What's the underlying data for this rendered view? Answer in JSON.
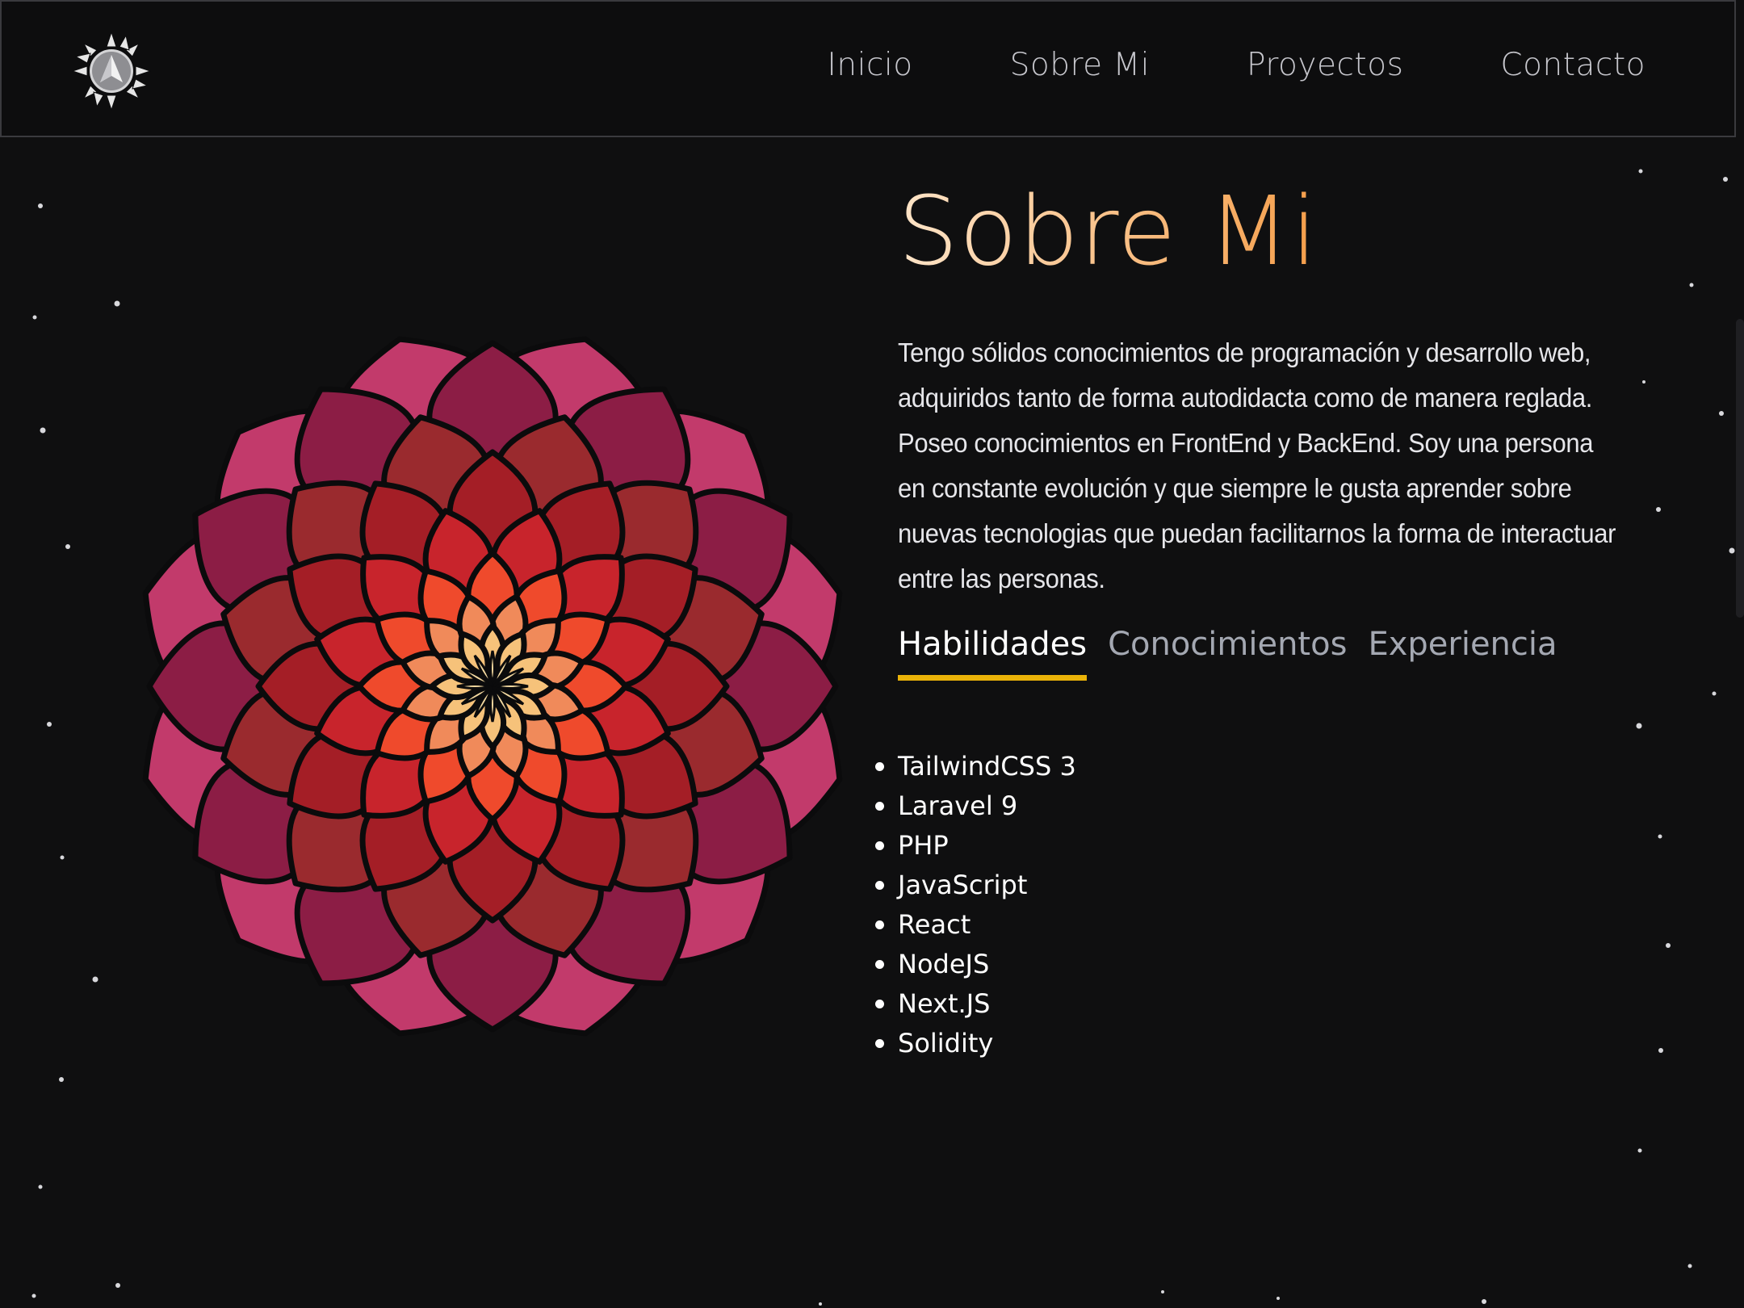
{
  "nav": {
    "logo_icon": "compass-star-logo-icon",
    "links": [
      {
        "label": "Inicio"
      },
      {
        "label": "Sobre Mi"
      },
      {
        "label": "Proyectos"
      },
      {
        "label": "Contacto"
      }
    ]
  },
  "about": {
    "title": "Sobre Mi",
    "description": "Tengo sólidos conocimientos de programación y desarrollo web, adquiridos tanto de forma autodidacta como de manera reglada. Poseo conocimientos en FrontEnd y BackEnd. Soy una persona en constante evolución y que siempre le gusta aprender sobre nuevas tecnologias que puedan facilitarnos la forma de interactuar entre las personas.",
    "image_icon": "mandala-flower-image",
    "tabs": [
      {
        "label": "Habilidades",
        "active": true
      },
      {
        "label": "Conocimientos",
        "active": false
      },
      {
        "label": "Experiencia",
        "active": false
      }
    ],
    "skills": [
      "TailwindCSS 3",
      "Laravel 9",
      "PHP",
      "JavaScript",
      "React",
      "NodeJS",
      "Next.JS",
      "Solidity"
    ]
  },
  "colors": {
    "background": "#0f0f10",
    "title_gradient_start": "#fde4c8",
    "title_gradient_end": "#f59e4a",
    "tab_underline": "#eab308",
    "tab_inactive": "#a4a8b2"
  }
}
